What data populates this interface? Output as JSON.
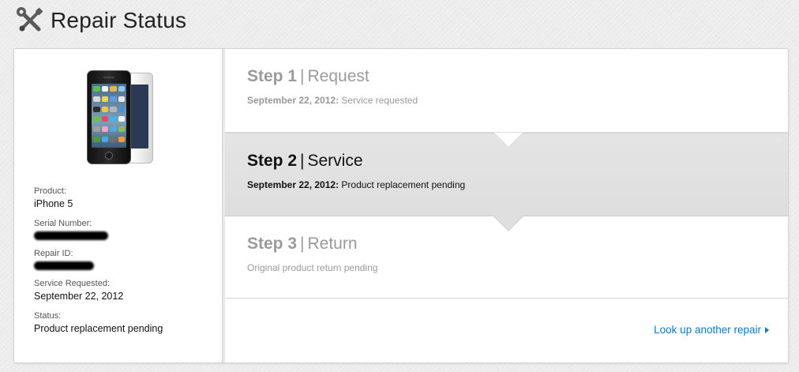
{
  "header": {
    "title": "Repair Status",
    "icon": "tools-icon"
  },
  "product_panel": {
    "image": "iphone-5-image",
    "fields": [
      {
        "label": "Product:",
        "value": "iPhone 5",
        "redacted": false
      },
      {
        "label": "Serial Number:",
        "value": "",
        "redacted": true
      },
      {
        "label": "Repair ID:",
        "value": "",
        "redacted": true
      },
      {
        "label": "Service Requested:",
        "value": "September 22, 2012",
        "redacted": false
      },
      {
        "label": "Status:",
        "value": "Product replacement pending",
        "redacted": false
      }
    ]
  },
  "steps": [
    {
      "number": "Step 1",
      "separator": "|",
      "name": "Request",
      "date": "September 22, 2012:",
      "detail": "Service requested",
      "active": false
    },
    {
      "number": "Step 2",
      "separator": "|",
      "name": "Service",
      "date": "September 22, 2012:",
      "detail": "Product replacement pending",
      "active": true
    },
    {
      "number": "Step 3",
      "separator": "|",
      "name": "Return",
      "date": "",
      "detail": "Original product return pending",
      "active": false
    }
  ],
  "lookup_link": {
    "label": "Look up another repair",
    "icon": "chevron-right-icon"
  },
  "colors": {
    "link": "#0b7ac7",
    "active_step_bg": "#e0e0e0",
    "inactive_text": "#9a9a9a"
  }
}
